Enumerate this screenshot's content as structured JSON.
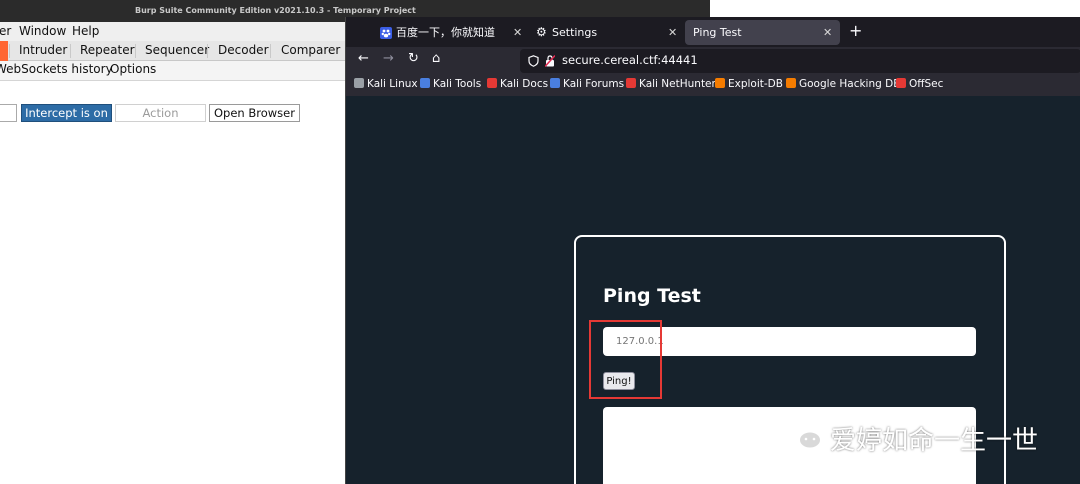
{
  "burp": {
    "title": "Burp Suite Community Edition v2021.10.3 - Temporary Project",
    "menu": [
      "er",
      "Window",
      "Help"
    ],
    "tabs": [
      "Intruder",
      "Repeater",
      "Sequencer",
      "Decoder",
      "Comparer"
    ],
    "subtabs": [
      "WebSockets history",
      "Options"
    ],
    "buttons": {
      "intercept": "Intercept is on",
      "action": "Action",
      "open_browser": "Open Browser"
    }
  },
  "firefox": {
    "tabs": [
      {
        "label": "百度一下，你就知道",
        "icon": "paw-icon"
      },
      {
        "label": "Settings",
        "icon": "gear-icon"
      },
      {
        "label": "Ping Test",
        "icon": "none"
      }
    ],
    "url": "secure.cereal.ctf:44441",
    "bookmarks": [
      {
        "label": "Kali Linux",
        "color": "#9aa0a6"
      },
      {
        "label": "Kali Tools",
        "color": "#4a7fe0"
      },
      {
        "label": "Kali Docs",
        "color": "#e53935"
      },
      {
        "label": "Kali Forums",
        "color": "#4a7fe0"
      },
      {
        "label": "Kali NetHunter",
        "color": "#e53935"
      },
      {
        "label": "Exploit-DB",
        "color": "#f57c00"
      },
      {
        "label": "Google Hacking DB",
        "color": "#f57c00"
      },
      {
        "label": "OffSec",
        "color": "#e53935"
      }
    ]
  },
  "page": {
    "title": "Ping Test",
    "input_placeholder": "127.0.0.1",
    "button_label": "Ping!",
    "background": "#16222c"
  },
  "watermark": {
    "text": "爱婷如命一生一世"
  }
}
